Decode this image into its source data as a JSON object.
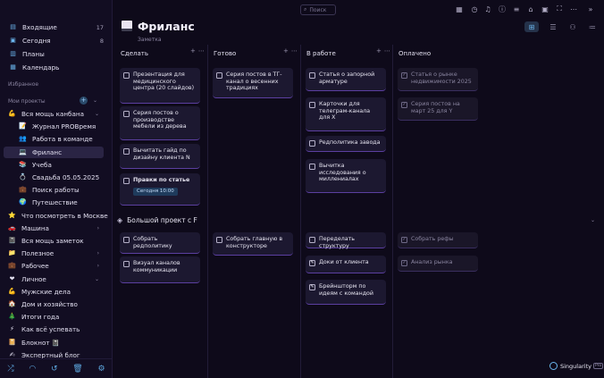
{
  "sidebar": {
    "top_items": [
      {
        "label": "Входящие",
        "count": "17",
        "icon": "inbox-icon"
      },
      {
        "label": "Сегодня",
        "count": "8",
        "icon": "calendar-day-icon"
      },
      {
        "label": "Планы",
        "count": "",
        "icon": "plans-icon"
      },
      {
        "label": "Календарь",
        "count": "",
        "icon": "calendar-icon"
      }
    ],
    "favorites_label": "Избранное",
    "projects_label": "Мои проекты",
    "projects": [
      {
        "label": "Вся мощь канбана",
        "icon": "💪",
        "level": 0,
        "chevron": "⌄"
      },
      {
        "label": "Журнал PROВремя",
        "icon": "📝",
        "level": 1
      },
      {
        "label": "Работа в команде",
        "icon": "👥",
        "level": 1
      },
      {
        "label": "Фриланс",
        "icon": "💻",
        "level": 1,
        "selected": true
      },
      {
        "label": "Учеба",
        "icon": "📚",
        "level": 1
      },
      {
        "label": "Свадьба 05.05.2025",
        "icon": "💍",
        "level": 1
      },
      {
        "label": "Поиск работы",
        "icon": "💼",
        "level": 1
      },
      {
        "label": "Путешествие",
        "icon": "🌍",
        "level": 1
      },
      {
        "label": "Что посмотреть в Москве",
        "icon": "⭐",
        "level": 0
      },
      {
        "label": "Машина",
        "icon": "🚗",
        "level": 0,
        "chevron": "›"
      },
      {
        "label": "Вся мощь заметок",
        "icon": "📓",
        "level": 0
      },
      {
        "label": "Полезное",
        "icon": "📁",
        "level": 0,
        "chevron": "›"
      },
      {
        "label": "Рабочее",
        "icon": "💼",
        "level": 0,
        "chevron": "›"
      },
      {
        "label": "Личное",
        "icon": "❤",
        "level": 0,
        "chevron": "⌄"
      },
      {
        "label": "Мужские дела",
        "icon": "💪",
        "level": 0
      },
      {
        "label": "Дом и хозяйство",
        "icon": "🏠",
        "level": 0
      },
      {
        "label": "Итоги года",
        "icon": "🎄",
        "level": 0
      },
      {
        "label": "Как всё успевать",
        "icon": "⚡",
        "level": 0
      },
      {
        "label": "Блокнот 📓",
        "icon": "📔",
        "level": 0
      },
      {
        "label": "Экспертный блог",
        "icon": "✍",
        "level": 0
      }
    ],
    "bottom_icons": [
      "shuffle-icon",
      "signal-icon",
      "history-icon",
      "trash-icon",
      "settings-icon"
    ]
  },
  "topbar": {
    "search_placeholder": "Поиск"
  },
  "page": {
    "title": "Фриланс",
    "subtitle": "Заметка"
  },
  "columns": [
    {
      "title": "Сделать"
    },
    {
      "title": "Готово"
    },
    {
      "title": "В работе"
    },
    {
      "title": "Оплачено"
    }
  ],
  "group1_cards": [
    [
      {
        "text": "Презентация для медицинского центра (20 слайдов)",
        "done": false
      },
      {
        "text": "Серия постов о производстве мебели из дерева",
        "done": false
      },
      {
        "text": "Вычитать гайд по дизайну клиента N",
        "done": false
      },
      {
        "text": "Правки по статье",
        "done": false,
        "bold": true,
        "badge": "Сегодня 10:00"
      }
    ],
    [
      {
        "text": "Серия постов в ТГ-канал о весенних традициях",
        "done": false
      }
    ],
    [
      {
        "text": "Статья о запорной арматуре",
        "done": false
      },
      {
        "text": "Карточки для телеграм-канала для Х",
        "done": false
      },
      {
        "text": "Редполитика завода",
        "done": false
      },
      {
        "text": "Вычитка исследования о миллениалах",
        "done": false
      }
    ],
    [
      {
        "text": "Статья о рынке недвижимости 2025",
        "done": true
      },
      {
        "text": "Серия постов на март 25 для Y",
        "done": true
      }
    ]
  ],
  "group2": {
    "title": "Большой проект с F"
  },
  "group2_cards": [
    [
      {
        "text": "Собрать редполитику",
        "done": false
      },
      {
        "text": "Визуал каналов коммуникации",
        "done": false
      }
    ],
    [
      {
        "text": "Собрать главную в конструкторе",
        "done": false
      }
    ],
    [
      {
        "text": "Переделать структуру",
        "done": false
      },
      {
        "text": "Доки от клиента",
        "done": false,
        "note": true
      },
      {
        "text": "Брейншторм по идеям с командой",
        "done": false,
        "note": true
      }
    ],
    [
      {
        "text": "Собрать рефы",
        "done": true
      },
      {
        "text": "Анализ рынка",
        "done": true
      }
    ]
  ],
  "brand": {
    "name": "Singularity",
    "tag": "Pro"
  }
}
